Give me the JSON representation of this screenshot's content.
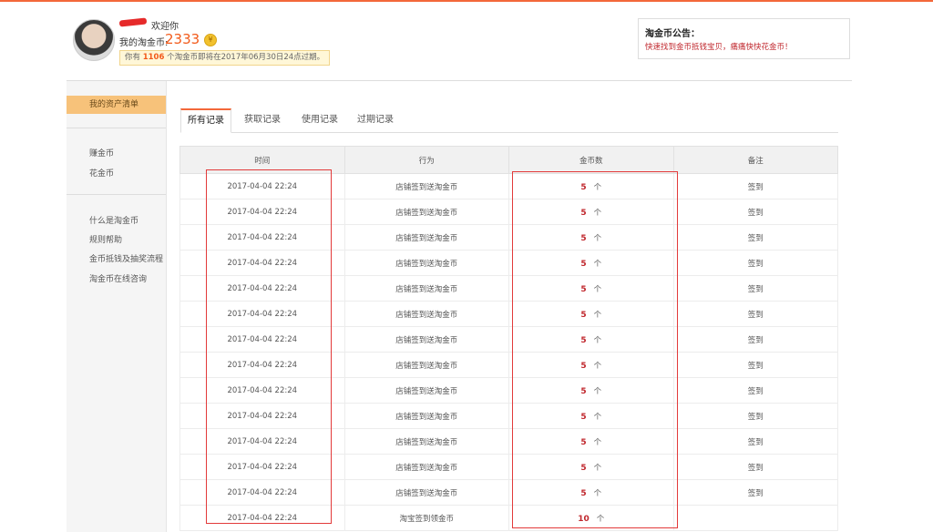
{
  "header": {
    "welcome": "欢迎你",
    "my_coin_label": "我的淘金币:",
    "coin_total": "2333",
    "coin_icon": "coin-icon",
    "expire_prefix": "你有",
    "expire_count": "1106",
    "expire_suffix": "个淘金币即将在2017年06月30日24点过期。"
  },
  "notice": {
    "title": "淘金币公告：",
    "body": "快速找到金币抵钱宝贝，痛痛快快花金币！"
  },
  "sidebar": {
    "active": "我的资产清单",
    "group1": [
      "赚金币",
      "花金币"
    ],
    "group2": [
      "什么是淘金币",
      "规则帮助",
      "金币抵钱及抽奖流程",
      "淘金币在线咨询"
    ]
  },
  "tabs": [
    "所有记录",
    "获取记录",
    "使用记录",
    "过期记录"
  ],
  "table": {
    "headers": [
      "时间",
      "行为",
      "金币数",
      "备注"
    ],
    "unit": "个",
    "rows": [
      {
        "time": "2017-04-04 22:24",
        "action": "店铺签到送淘金币",
        "amount": "5",
        "note": "签到"
      },
      {
        "time": "2017-04-04 22:24",
        "action": "店铺签到送淘金币",
        "amount": "5",
        "note": "签到"
      },
      {
        "time": "2017-04-04 22:24",
        "action": "店铺签到送淘金币",
        "amount": "5",
        "note": "签到"
      },
      {
        "time": "2017-04-04 22:24",
        "action": "店铺签到送淘金币",
        "amount": "5",
        "note": "签到"
      },
      {
        "time": "2017-04-04 22:24",
        "action": "店铺签到送淘金币",
        "amount": "5",
        "note": "签到"
      },
      {
        "time": "2017-04-04 22:24",
        "action": "店铺签到送淘金币",
        "amount": "5",
        "note": "签到"
      },
      {
        "time": "2017-04-04 22:24",
        "action": "店铺签到送淘金币",
        "amount": "5",
        "note": "签到"
      },
      {
        "time": "2017-04-04 22:24",
        "action": "店铺签到送淘金币",
        "amount": "5",
        "note": "签到"
      },
      {
        "time": "2017-04-04 22:24",
        "action": "店铺签到送淘金币",
        "amount": "5",
        "note": "签到"
      },
      {
        "time": "2017-04-04 22:24",
        "action": "店铺签到送淘金币",
        "amount": "5",
        "note": "签到"
      },
      {
        "time": "2017-04-04 22:24",
        "action": "店铺签到送淘金币",
        "amount": "5",
        "note": "签到"
      },
      {
        "time": "2017-04-04 22:24",
        "action": "店铺签到送淘金币",
        "amount": "5",
        "note": "签到"
      },
      {
        "time": "2017-04-04 22:24",
        "action": "店铺签到送淘金币",
        "amount": "5",
        "note": "签到"
      },
      {
        "time": "2017-04-04 22:24",
        "action": "淘宝签到领金币",
        "amount": "10",
        "note": ""
      }
    ]
  },
  "colors": {
    "accent": "#f3683a",
    "coin": "#f25a1a",
    "highlight": "#e23a3a"
  }
}
